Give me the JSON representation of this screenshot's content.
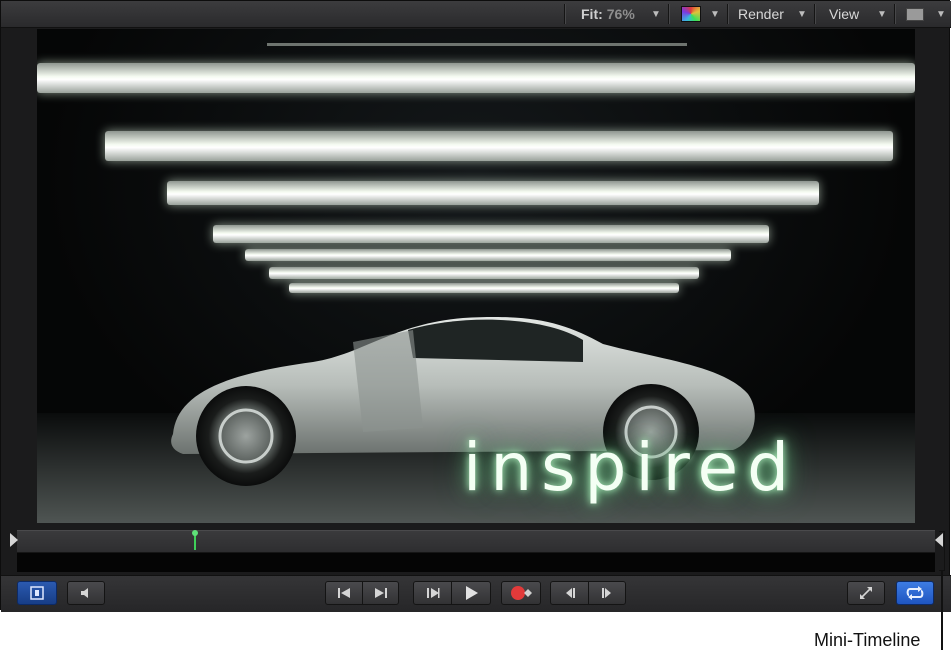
{
  "toolbar": {
    "fit_label": "Fit:",
    "fit_value": "76%",
    "render_label": "Render",
    "view_label": "View"
  },
  "canvas": {
    "title_text": "inspired"
  },
  "callout": {
    "label": "Mini-Timeline"
  },
  "icons": {
    "chevron": "chevron-down-icon",
    "color_channels": "color-swatch-icon",
    "view_layout": "window-layout-icon",
    "layers": "layers-panel-icon",
    "audio": "speaker-icon",
    "go_start": "go-to-start-icon",
    "go_end": "go-to-end-icon",
    "prev_frame": "previous-frame-icon",
    "play": "play-icon",
    "record": "record-icon",
    "prev_keyframe": "previous-keyframe-icon",
    "next_keyframe": "next-keyframe-icon",
    "fullscreen": "fullscreen-icon",
    "loop": "loop-icon"
  },
  "colors": {
    "accent_blue": "#2f6fd8",
    "playhead_green": "#3fcf59",
    "record_red": "#e23a3a"
  }
}
